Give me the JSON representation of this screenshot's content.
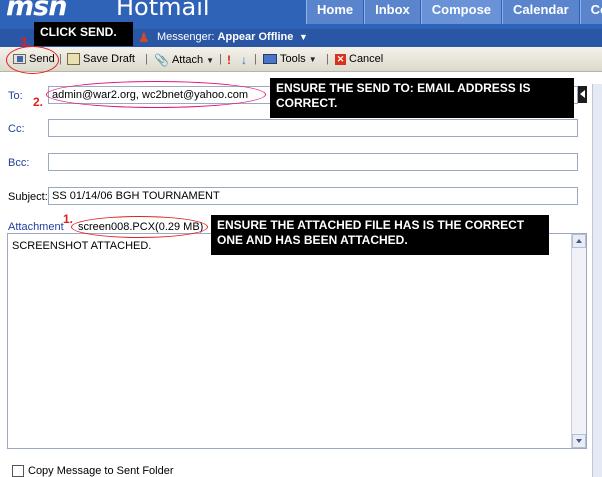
{
  "header": {
    "logo_text": "msn",
    "app_title": "Hotmail",
    "tabs": [
      {
        "label": "Home"
      },
      {
        "label": "Inbox"
      },
      {
        "label": "Compose"
      },
      {
        "label": "Calendar"
      },
      {
        "label": "Cont"
      }
    ],
    "active_tab": "Compose",
    "messenger_label": "Messenger:",
    "messenger_status": "Appear Offline"
  },
  "toolbar": {
    "send": "Send",
    "save_draft": "Save Draft",
    "attach": "Attach",
    "tools": "Tools",
    "cancel": "Cancel",
    "separator": "|"
  },
  "form": {
    "to_label": "To:",
    "to_value": "admin@war2.org, wc2bnet@yahoo.com",
    "cc_label": "Cc:",
    "cc_value": "",
    "bcc_label": "Bcc:",
    "bcc_value": "",
    "subject_label": "Subject:",
    "subject_value": "SS 01/14/06 BGH TOURNAMENT",
    "attachments_label": "Attachment",
    "attachment_file": "screen008.PCX(0.29 MB)",
    "body_text": "SCREENSHOT ATTACHED.",
    "copy_label": "Copy Message to Sent Folder"
  },
  "annotations": {
    "step1_num": "1.",
    "step2_num": "2.",
    "step3_num": "3.",
    "click_send": "CLICK SEND.",
    "ensure_to": "ENSURE THE SEND TO: EMAIL ADDRESS IS CORRECT.",
    "ensure_attach": "ENSURE THE ATTACHED FILE HAS IS THE CORRECT ONE AND HAS BEEN ATTACHED."
  },
  "colors": {
    "header_blue": "#2f63b8",
    "oval_pink": "#e0157c",
    "number_red": "#e02020"
  }
}
